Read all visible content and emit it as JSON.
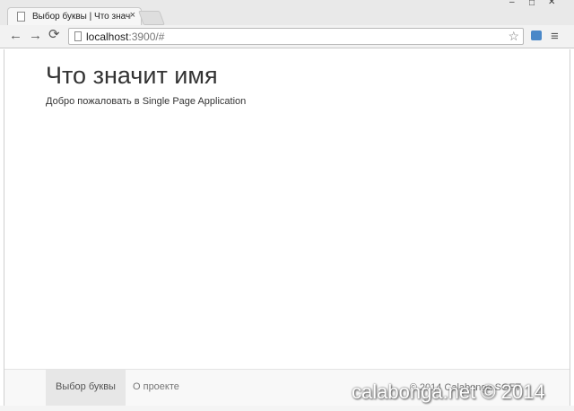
{
  "browser": {
    "tab_title": "Выбор буквы | Что значи",
    "tab_close": "×",
    "url_host": "localhost",
    "url_rest": ":3900/#",
    "window_controls": {
      "minimize": "–",
      "maximize": "□",
      "close": "✕"
    },
    "icons": {
      "back": "←",
      "forward": "→",
      "reload": "⟳",
      "star": "☆",
      "menu": "≡"
    }
  },
  "page": {
    "title": "Что значит имя",
    "subtitle": "Добро пожаловать в Single Page Application"
  },
  "footer": {
    "nav": [
      {
        "label": "Выбор буквы",
        "active": true
      },
      {
        "label": "О проекте",
        "active": false
      }
    ],
    "copyright": "© 2014 Calabonga SOFT"
  },
  "watermark": "calabonga.net © 2014"
}
